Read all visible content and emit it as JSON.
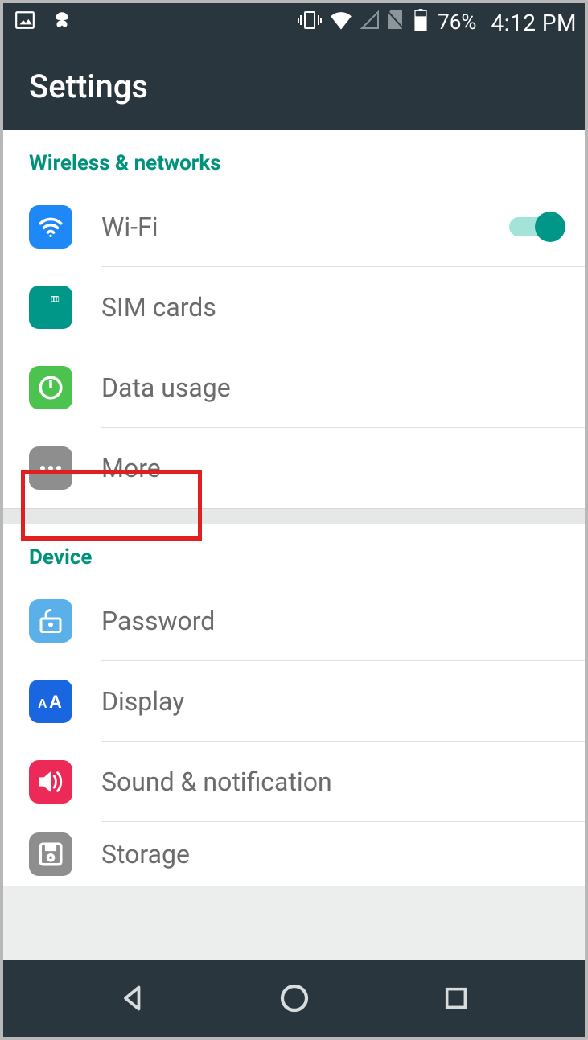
{
  "status": {
    "battery_pct": "76%",
    "time": "4:12 PM"
  },
  "appbar": {
    "title": "Settings"
  },
  "sections": {
    "wireless": {
      "header": "Wireless & networks",
      "wifi": "Wi-Fi",
      "sim": "SIM cards",
      "data": "Data usage",
      "more": "More",
      "wifi_on": true
    },
    "device": {
      "header": "Device",
      "password": "Password",
      "display": "Display",
      "sound": "Sound & notification",
      "storage": "Storage"
    }
  }
}
